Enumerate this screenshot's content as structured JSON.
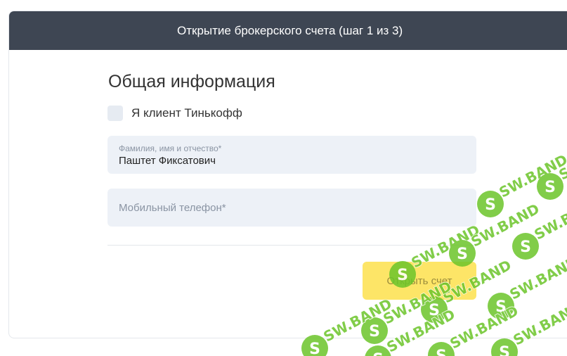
{
  "header": {
    "title": "Открытие брокерского счета (шаг 1 из 3)"
  },
  "form": {
    "section_title": "Общая информация",
    "client_checkbox": {
      "label": "Я клиент Тинькофф",
      "checked": false
    },
    "fio_field": {
      "label": "Фамилия, имя и отчество*",
      "value": "Паштет Фиксатович"
    },
    "phone_field": {
      "placeholder": "Мобильный телефон*"
    },
    "submit_label": "Открыть счет"
  },
  "watermark": {
    "text": "SW.BAND",
    "logo_letter": "S",
    "color": "#6cc52a"
  },
  "colors": {
    "header_bg": "#3e4653",
    "field_bg": "#edf1f7",
    "button_bg": "#fde567"
  }
}
